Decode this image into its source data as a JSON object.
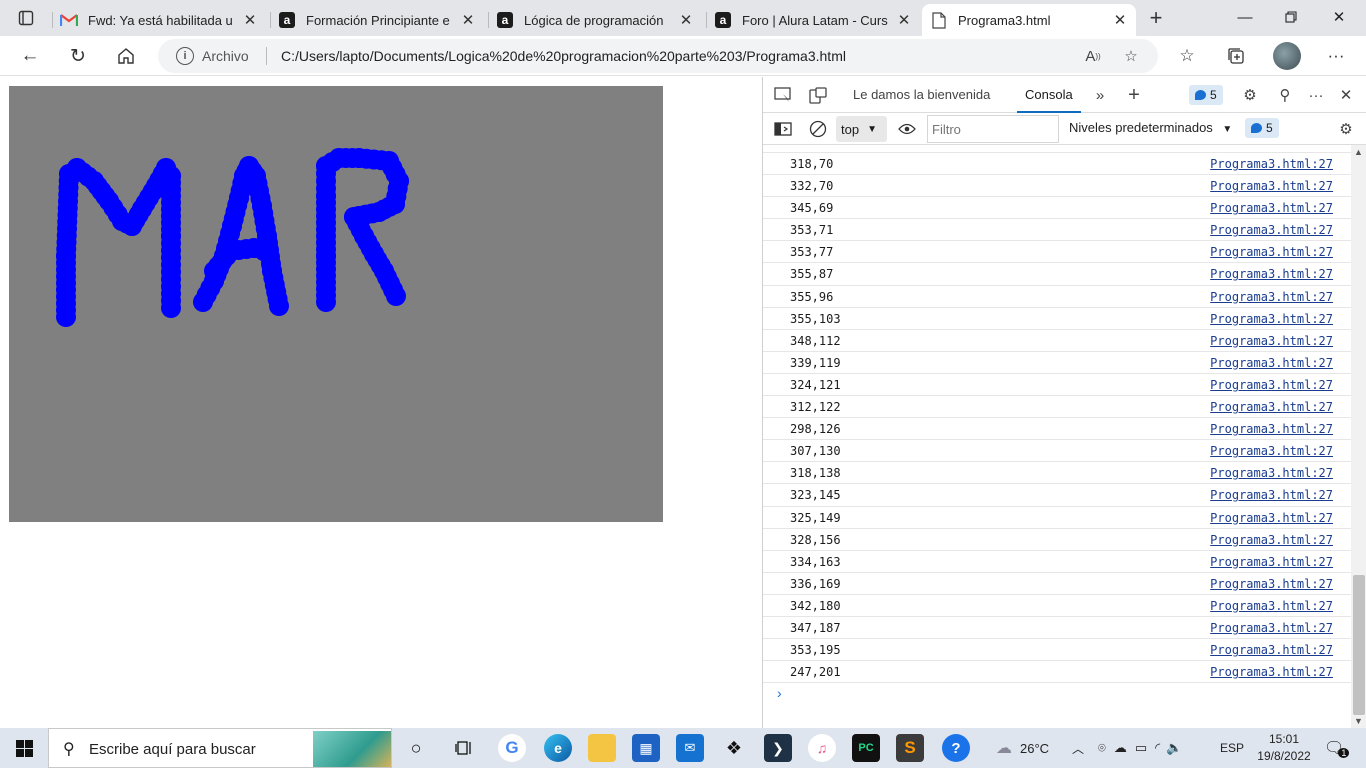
{
  "browser": {
    "tabs": [
      {
        "title": "Fwd: Ya está habilitada u",
        "icon": "gmail-icon",
        "active": false
      },
      {
        "title": "Formación Principiante e",
        "icon": "alura-icon",
        "active": false
      },
      {
        "title": "Lógica de programación",
        "icon": "alura-icon",
        "active": false
      },
      {
        "title": "Foro | Alura Latam - Curs",
        "icon": "alura-icon",
        "active": false
      },
      {
        "title": "Programa3.html",
        "icon": "file-icon",
        "active": true
      }
    ],
    "address": {
      "label": "Archivo",
      "url": "C:/Users/lapto/Documents/Logica%20de%20programacion%20parte%203/Programa3.html"
    }
  },
  "canvas": {
    "background": "#808080",
    "dot_color": "#0000ff",
    "drawn_text": "MAR"
  },
  "devtools": {
    "tabs": [
      "Le damos la bienvenida",
      "Consola"
    ],
    "active_tab": "Consola",
    "issues_count": "5",
    "context": "top",
    "filter_placeholder": "Filtro",
    "levels": "Niveles predeterminados",
    "messages_count": "5",
    "console_rows": [
      {
        "msg": "318,70",
        "src": "Programa3.html:27"
      },
      {
        "msg": "332,70",
        "src": "Programa3.html:27"
      },
      {
        "msg": "345,69",
        "src": "Programa3.html:27"
      },
      {
        "msg": "353,71",
        "src": "Programa3.html:27"
      },
      {
        "msg": "353,77",
        "src": "Programa3.html:27"
      },
      {
        "msg": "355,87",
        "src": "Programa3.html:27"
      },
      {
        "msg": "355,96",
        "src": "Programa3.html:27"
      },
      {
        "msg": "355,103",
        "src": "Programa3.html:27"
      },
      {
        "msg": "348,112",
        "src": "Programa3.html:27"
      },
      {
        "msg": "339,119",
        "src": "Programa3.html:27"
      },
      {
        "msg": "324,121",
        "src": "Programa3.html:27"
      },
      {
        "msg": "312,122",
        "src": "Programa3.html:27"
      },
      {
        "msg": "298,126",
        "src": "Programa3.html:27"
      },
      {
        "msg": "307,130",
        "src": "Programa3.html:27"
      },
      {
        "msg": "318,138",
        "src": "Programa3.html:27"
      },
      {
        "msg": "323,145",
        "src": "Programa3.html:27"
      },
      {
        "msg": "325,149",
        "src": "Programa3.html:27"
      },
      {
        "msg": "328,156",
        "src": "Programa3.html:27"
      },
      {
        "msg": "334,163",
        "src": "Programa3.html:27"
      },
      {
        "msg": "336,169",
        "src": "Programa3.html:27"
      },
      {
        "msg": "342,180",
        "src": "Programa3.html:27"
      },
      {
        "msg": "347,187",
        "src": "Programa3.html:27"
      },
      {
        "msg": "353,195",
        "src": "Programa3.html:27"
      },
      {
        "msg": "247,201",
        "src": "Programa3.html:27"
      }
    ],
    "prompt_symbol": "›"
  },
  "taskbar": {
    "search_placeholder": "Escribe aquí para buscar",
    "weather": "26°C",
    "language": "ESP",
    "time": "15:01",
    "date": "19/8/2022",
    "notifications": "1"
  }
}
